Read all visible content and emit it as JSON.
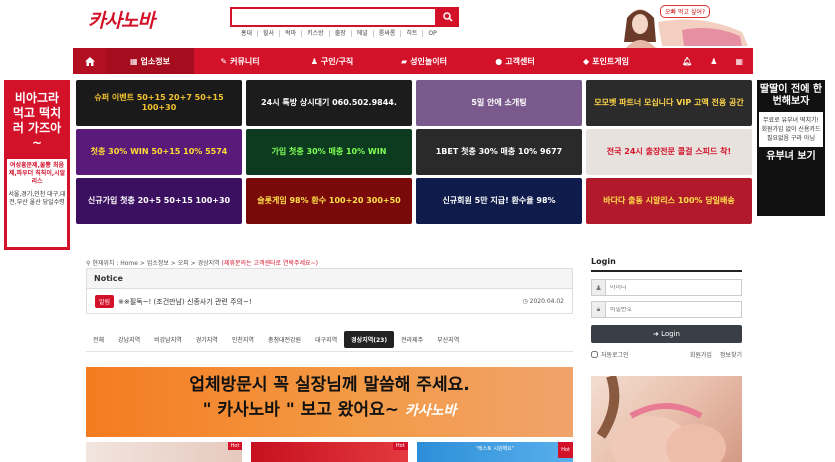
{
  "header": {
    "logo_text": "카사노바",
    "search": {
      "placeholder": "",
      "value": ""
    },
    "quick_links": [
      "홍대",
      "힐사",
      "럭마",
      "키스방",
      "출장",
      "에널",
      "룸싸롱",
      "히트",
      "OP"
    ],
    "promo_bubble": "오빠 먹고 싶어?"
  },
  "nav": {
    "items": [
      "업소정보",
      "커뮤니티",
      "구인/구직",
      "성인놀이터",
      "고객센터",
      "포인트게임"
    ],
    "active_index": 0
  },
  "side_left": {
    "headline": "비아그라 먹고 떡치러 가즈아~",
    "sub1": "여성흥분제,물뽕 최음제,파우더 칙칙이,시알리스",
    "sub2": "서울,경기,인천 대구,대전,부산 울산 당일수령"
  },
  "side_right": {
    "headline": "딸딸이 전에 한번해보자",
    "middle": "무료로 유부녀 떡치기! 회원가입 없이 신용카드 필요없음 구라 아님",
    "bottom": "유부녀 보기"
  },
  "banners": [
    {
      "text": "슈퍼 이벤트 50+15 20+7 50+15 100+30",
      "bg": "#1a1a1a",
      "fg": "#f2c230"
    },
    {
      "text": "24시 톡방 상시대기 060.502.9844.",
      "bg": "#1c1c1c",
      "fg": "#ffffff"
    },
    {
      "text": "5일 안에 소개팅",
      "bg": "#7a5a8c",
      "fg": "#ffffff"
    },
    {
      "text": "모모벳 파트너 모십니다 VIP 고액 전용 공간",
      "bg": "#2b2b2b",
      "fg": "#ffd54a"
    },
    {
      "text": "첫충 30% WIN 50+15 10% 5574",
      "bg": "#5a1a7a",
      "fg": "#ffdd33"
    },
    {
      "text": "가입 첫충 30% 매충 10% WIN",
      "bg": "#0d3b1f",
      "fg": "#7fff55"
    },
    {
      "text": "1BET 첫충 30% 매충 10% 9677",
      "bg": "#2a2a2a",
      "fg": "#ffffff"
    },
    {
      "text": "전국 24시 출장전문 콜걸 스피드 착!",
      "bg": "#e8e2de",
      "fg": "#d3122a"
    },
    {
      "text": "신규가입 첫충 20+5 50+15 100+30",
      "bg": "#3b1060",
      "fg": "#ffffff"
    },
    {
      "text": "슬롯게임 98% 환수 100+20 300+50",
      "bg": "#7a0a0a",
      "fg": "#ffe14a"
    },
    {
      "text": "신규회원 5만 지급! 환수율 98%",
      "bg": "#0f1b4a",
      "fg": "#ffffff"
    },
    {
      "text": "바다다 출동 시알리스 100% 당일배송",
      "bg": "#b01a2a",
      "fg": "#ffe14a"
    }
  ],
  "breadcrumb": {
    "text": "현재위치 : Home > 업소정보 > 오피 > 경상지역",
    "note": "(제휴문의는 고객센터로 연락주세요~)"
  },
  "notice": {
    "title": "Notice",
    "badge": "알림",
    "text": "※※필독~! (조건만남) 신종사기 관련 주의~!",
    "date": "2020.04.02"
  },
  "region_tabs": {
    "items": [
      "전체",
      "강남지역",
      "비강남지역",
      "경기지역",
      "인천지역",
      "충청대전강원",
      "대구지역",
      "경상지역(23)",
      "전라제주",
      "부산지역"
    ],
    "active_index": 7
  },
  "orange_banner": {
    "line1": "업체방문시 꼭 실장님께 말씀해 주세요.",
    "line2": "\" 카사노바 \" 보고 왔어요~",
    "signature": "카사노바"
  },
  "thumbs": {
    "hot_label": "Hot",
    "middle_text": "\"레스토 시원해요\""
  },
  "login": {
    "title": "Login",
    "id_placeholder": "아이디",
    "pw_placeholder": "비밀번호",
    "button": "Login",
    "auto_login": "자동로그인",
    "join": "회원가입",
    "find": "정보찾기"
  },
  "colors": {
    "brand_red": "#d3122a",
    "dark_button": "#3a3f47",
    "orange": "#f47b20"
  }
}
